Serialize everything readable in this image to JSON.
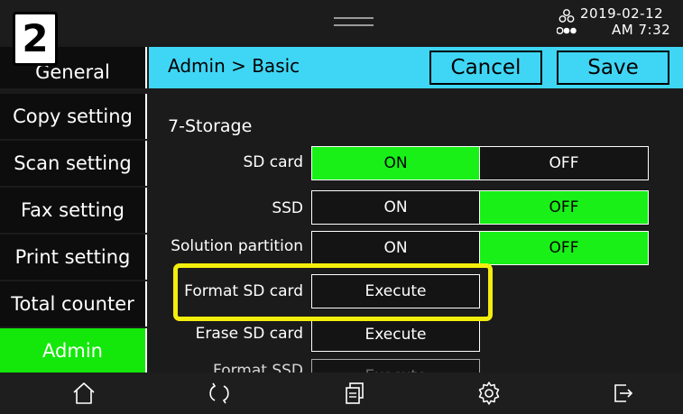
{
  "step_badge": "2",
  "status": {
    "date": "2019-02-12",
    "time": "AM 7:32"
  },
  "sidebar": {
    "items": [
      {
        "label": "General"
      },
      {
        "label": "Copy setting"
      },
      {
        "label": "Scan setting"
      },
      {
        "label": "Fax setting"
      },
      {
        "label": "Print setting"
      },
      {
        "label": "Total counter"
      },
      {
        "label": "Admin",
        "active": true
      }
    ]
  },
  "header": {
    "breadcrumb": "Admin > Basic",
    "cancel_label": "Cancel",
    "save_label": "Save"
  },
  "main": {
    "section_title": "7-Storage",
    "rows": [
      {
        "label": "SD card",
        "on_label": "ON",
        "off_label": "OFF",
        "selected": "ON"
      },
      {
        "label": "SSD",
        "on_label": "ON",
        "off_label": "OFF",
        "selected": "OFF"
      },
      {
        "label": "Solution partition",
        "on_label": "ON",
        "off_label": "OFF",
        "selected": "OFF"
      },
      {
        "label": "Format SD card",
        "button_label": "Execute"
      },
      {
        "label": "Erase SD card",
        "button_label": "Execute"
      },
      {
        "label": "Format SSD",
        "button_label": "Execute"
      }
    ]
  },
  "colors": {
    "active_green": "#13e80a",
    "header_cyan": "#3fd6f5",
    "highlight_yellow": "#f3ee0c"
  },
  "bottom_icons": [
    "home-icon",
    "refresh-icon",
    "copy-icon",
    "settings-gear-icon",
    "logout-icon"
  ]
}
